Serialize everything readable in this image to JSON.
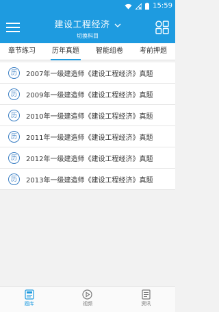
{
  "status": {
    "time": "15:59"
  },
  "header": {
    "title": "建设工程经济",
    "subtitle": "切换科目"
  },
  "tabs": [
    {
      "label": "章节练习",
      "active": false
    },
    {
      "label": "历年真题",
      "active": true
    },
    {
      "label": "智能组卷",
      "active": false
    },
    {
      "label": "考前押题",
      "active": false
    }
  ],
  "list": {
    "badge": "历",
    "items": [
      "2007年一级建造师《建设工程经济》真题",
      "2009年一级建造师《建设工程经济》真题",
      "2010年一级建造师《建设工程经济》真题",
      "2011年一级建造师《建设工程经济》真题",
      "2012年一级建造师《建设工程经济》真题",
      "2013年一级建造师《建设工程经济》真题"
    ]
  },
  "bottom_nav": [
    {
      "label": "题库",
      "icon": "question-bank-icon",
      "active": true
    },
    {
      "label": "视频",
      "icon": "play-icon",
      "active": false
    },
    {
      "label": "资讯",
      "icon": "news-icon",
      "active": false
    }
  ],
  "colors": {
    "primary": "#1e9be0",
    "badge": "#3b7fc4",
    "background": "#f2f2f2"
  }
}
